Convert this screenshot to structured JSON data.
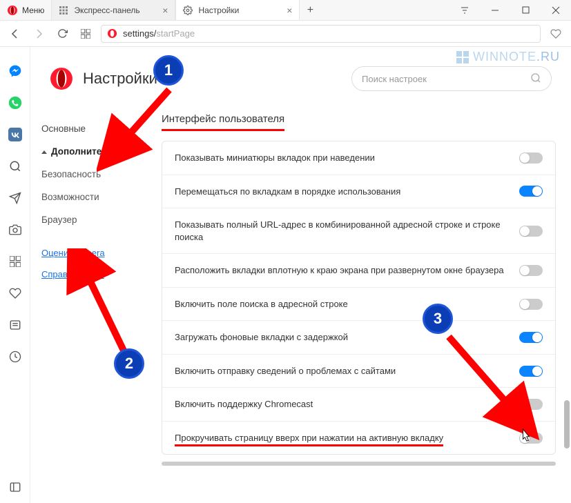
{
  "titlebar": {
    "menu_label": "Меню",
    "tab1_label": "Экспресс-панель",
    "tab2_label": "Настройки"
  },
  "addressbar": {
    "url_dark": "settings/",
    "url_dim": "startPage"
  },
  "watermark": {
    "part1": "WINNOTE",
    "part2": ".RU"
  },
  "header": {
    "title": "Настройки",
    "search_placeholder": "Поиск настроек"
  },
  "nav": {
    "basic": "Основные",
    "advanced": "Дополнительно",
    "security": "Безопасность",
    "features": "Возможности",
    "browser": "Браузер",
    "rate": "Оценить Opera",
    "help": "Справка Opera"
  },
  "section": {
    "title": "Интерфейс пользователя",
    "rows": [
      {
        "label": "Показывать миниатюры вкладок при наведении",
        "on": false
      },
      {
        "label": "Перемещаться по вкладкам в порядке использования",
        "on": true
      },
      {
        "label": "Показывать полный URL-адрес в комбинированной адресной строке и строке поиска",
        "on": false
      },
      {
        "label": "Расположить вкладки вплотную к краю экрана при развернутом окне браузера",
        "on": false
      },
      {
        "label": "Включить поле поиска в адресной строке",
        "on": false
      },
      {
        "label": "Загружать фоновые вкладки с задержкой",
        "on": true
      },
      {
        "label": "Включить отправку сведений о проблемах с сайтами",
        "on": true
      },
      {
        "label": "Включить поддержку Chromecast",
        "on": false
      },
      {
        "label": "Прокручивать страницу вверх при нажатии на активную вкладку",
        "on": false
      }
    ]
  },
  "annotations": {
    "b1": "1",
    "b2": "2",
    "b3": "3"
  }
}
